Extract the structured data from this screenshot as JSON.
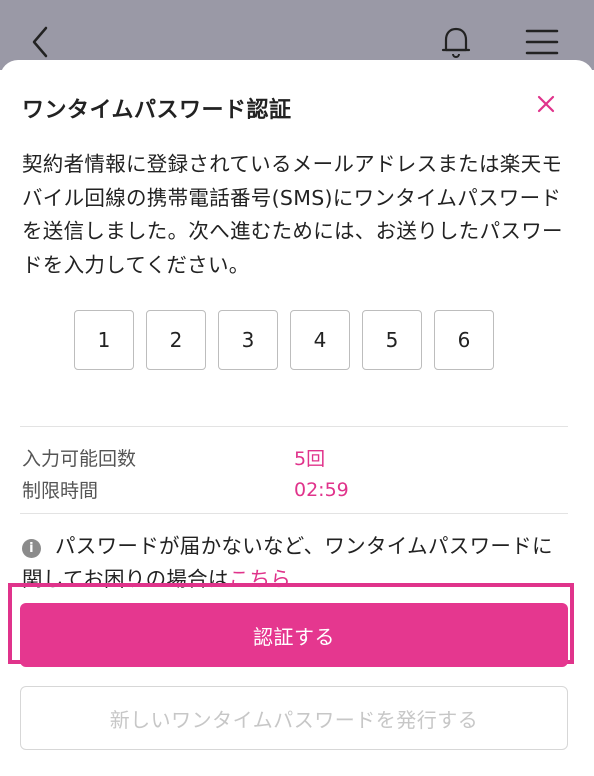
{
  "header": {
    "icons": {
      "back": "chevron-left-icon",
      "notifications": "bell-icon",
      "menu": "hamburger-menu-icon"
    }
  },
  "modal": {
    "title": "ワンタイムパスワード認証",
    "close_icon": "close-icon",
    "description": "契約者情報に登録されているメールアドレスまたは楽天モバイル回線の携帯電話番号(SMS)にワンタイムパスワードを送信しました。次へ進むためには、お送りしたパスワードを入力してください。",
    "otp_digits": [
      "1",
      "2",
      "3",
      "4",
      "5",
      "6"
    ],
    "attempts": {
      "label": "入力可能回数",
      "value": "5回"
    },
    "time_limit": {
      "label": "制限時間",
      "value": "02:59"
    },
    "notice": {
      "icon": "info-icon",
      "text": "パスワードが届かないなど、ワンタイムパスワードに関してお困りの場合は",
      "link_text": "こちら"
    },
    "verify_button": "認証する",
    "reissue_button": "新しいワンタイムパスワードを発行する"
  },
  "colors": {
    "accent": "#e0338b",
    "primary_button": "#e5378f",
    "overlay": "#9a99a6"
  }
}
